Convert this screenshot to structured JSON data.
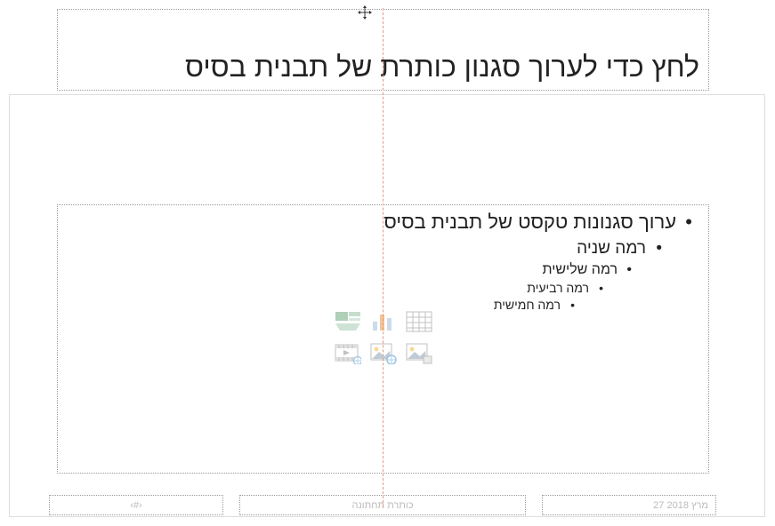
{
  "title": {
    "text": "לחץ כדי לערוך סגנון כותרת של תבנית בסיס"
  },
  "content": {
    "level1": "ערוך סגנונות טקסט של תבנית בסיס",
    "level2": "רמה שניה",
    "level3": "רמה שלישית",
    "level4": "רמה רביעית",
    "level5": "רמה חמישית"
  },
  "footer": {
    "slideNumber": "‹#›",
    "centerText": "כותרת תחתונה",
    "date": "27 מרץ 2018"
  },
  "icons": {
    "table": "table-icon",
    "chart": "chart-icon",
    "smartart": "smartart-icon",
    "picture": "picture-icon",
    "onlinePicture": "online-picture-icon",
    "video": "video-icon"
  }
}
